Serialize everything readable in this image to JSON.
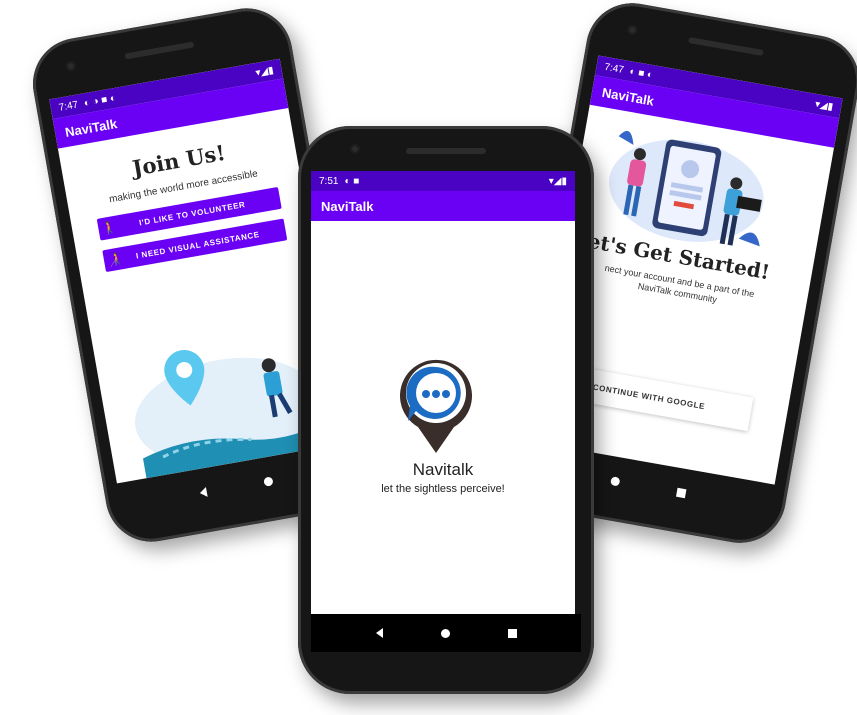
{
  "colors": {
    "primary": "#6a00f4",
    "status_bar": "#4a03c3",
    "bezel": "#161616"
  },
  "left_phone": {
    "status_time": "7:47",
    "app_title": "NaviTalk",
    "title": "Join Us!",
    "subtitle": "making the world more accessible",
    "volunteer_button": "I'D LIKE TO VOLUNTEER",
    "volunteer_icon": "person-hiking-icon",
    "assistance_button": "I NEED VISUAL ASSISTANCE",
    "assistance_icon": "blind-person-icon"
  },
  "center_phone": {
    "status_time": "7:51",
    "app_title": "NaviTalk",
    "logo_icon": "location-chat-bubble-icon",
    "title": "Navitalk",
    "tagline": "let the sightless perceive!"
  },
  "right_phone": {
    "status_time": "7:47",
    "app_title": "NaviTalk",
    "title": "et's Get Started!",
    "text_line1": "nect your account and be a part of the",
    "text_line2": "NaviTalk community",
    "google_button": "CONTINUE WITH GOOGLE"
  }
}
